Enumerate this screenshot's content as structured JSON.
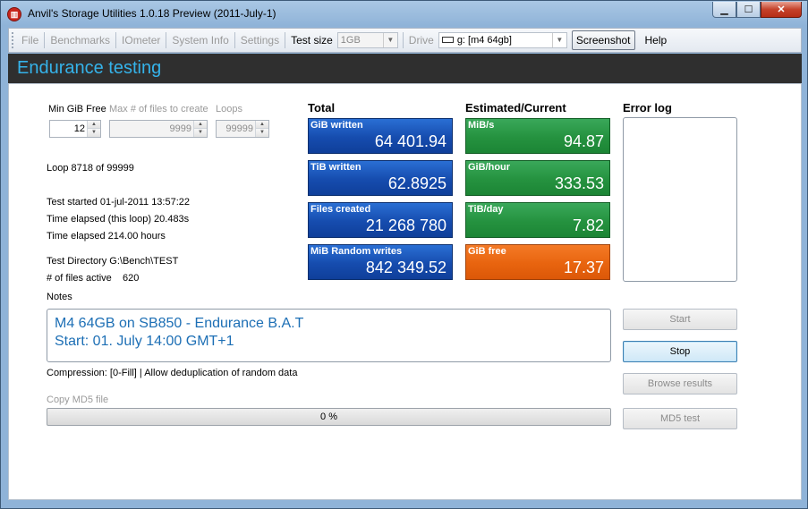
{
  "window": {
    "title": "Anvil's Storage Utilities 1.0.18 Preview (2011-July-1)",
    "app_icon_glyph": "▥",
    "buttons": {
      "minimize": "▁",
      "maximize": "☐",
      "close": "✕"
    }
  },
  "toolbar": {
    "file": "File",
    "benchmarks": "Benchmarks",
    "iometer": "IOmeter",
    "system_info": "System Info",
    "settings": "Settings",
    "test_size_label": "Test size",
    "test_size_value": "1GB",
    "drive_label": "Drive",
    "drive_value": "g: [m4 64gb]",
    "screenshot": "Screenshot",
    "help": "Help"
  },
  "header": {
    "title": "Endurance testing"
  },
  "params": {
    "min_free_label": "Min GiB Free",
    "min_free_value": "12",
    "max_files_label": "Max # of files to create",
    "max_files_value": "9999",
    "loops_label": "Loops",
    "loops_value": "99999"
  },
  "status": {
    "loop": "Loop 8718 of 99999",
    "test_started": "Test started 01-jul-2011 13:57:22",
    "time_elapsed_loop": "Time elapsed (this loop) 20.483s",
    "time_elapsed": "Time elapsed 214.00 hours",
    "test_directory": "Test Directory G:\\Bench\\TEST",
    "files_active_label": "# of files active",
    "files_active_value": "620",
    "notes_label": "Notes",
    "compression": "Compression: [0-Fill] | Allow deduplication of random data",
    "copy_md5": "Copy MD5 file"
  },
  "totals": {
    "title": "Total",
    "tiles": [
      {
        "label": "GiB written",
        "value": "64 401.94"
      },
      {
        "label": "TiB written",
        "value": "62.8925"
      },
      {
        "label": "Files created",
        "value": "21 268 780"
      },
      {
        "label": "MiB Random writes",
        "value": "842 349.52"
      }
    ]
  },
  "estimated": {
    "title": "Estimated/Current",
    "tiles": [
      {
        "label": "MiB/s",
        "value": "94.87"
      },
      {
        "label": "GiB/hour",
        "value": "333.53"
      },
      {
        "label": "TiB/day",
        "value": "7.82"
      },
      {
        "label": "GiB free",
        "value": "17.37"
      }
    ]
  },
  "error_log": {
    "title": "Error log"
  },
  "notes": {
    "line1": "M4 64GB on SB850 - Endurance B.A.T",
    "line2": "Start: 01. July 14:00 GMT+1"
  },
  "actions": {
    "start": "Start",
    "stop": "Stop",
    "browse_results": "Browse results",
    "md5_test": "MD5 test"
  },
  "progress": {
    "text": "0 %",
    "fraction": 0
  },
  "colors": {
    "header_bg": "#2f2f2f",
    "header_text": "#35b3ea",
    "tile_blue": "#164cae",
    "tile_green": "#25923f",
    "tile_orange": "#e8640f",
    "notes_text": "#1d6fb5"
  }
}
